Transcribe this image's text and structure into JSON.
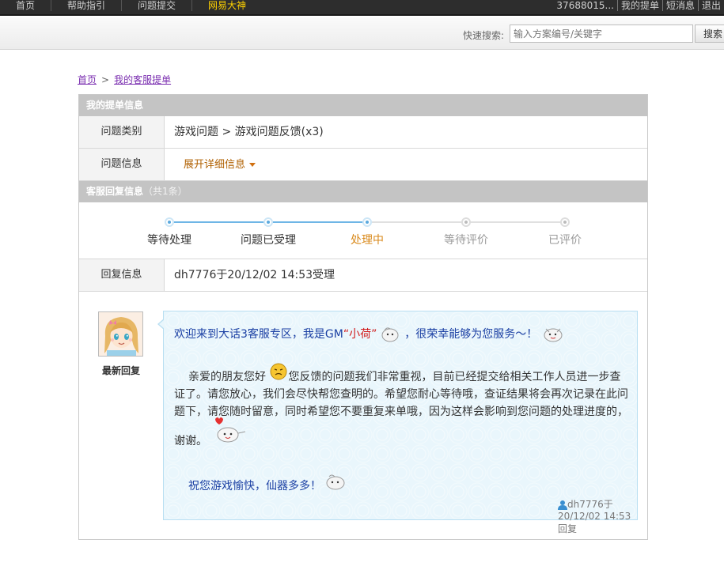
{
  "topnav": {
    "items": [
      "首页",
      "帮助指引",
      "问题提交",
      "网易大神"
    ],
    "right": [
      "37688015...",
      "我的提单",
      "短消息",
      "退出"
    ]
  },
  "search": {
    "label": "快速搜索:",
    "placeholder": "输入方案编号/关键字",
    "button": "搜索"
  },
  "breadcrumb": {
    "home": "首页",
    "current": "我的客服提单"
  },
  "ticket_info": {
    "header": "我的提单信息",
    "category_label": "问题类别",
    "category_value": "游戏问题 > 游戏问题反馈(x3)",
    "info_label": "问题信息",
    "expand_link": "展开详细信息"
  },
  "reply_info": {
    "header": "客服回复信息",
    "count": "（共1条）",
    "steps": [
      {
        "label": "等待处理",
        "state": "done"
      },
      {
        "label": "问题已受理",
        "state": "done"
      },
      {
        "label": "处理中",
        "state": "current"
      },
      {
        "label": "等待评价",
        "state": "pending"
      },
      {
        "label": "已评价",
        "state": "pending"
      }
    ],
    "reply_label": "回复信息",
    "reply_value": "dh7776于20/12/02 14:53受理"
  },
  "latest_reply": {
    "caption": "最新回复",
    "line1_a": "欢迎来到大话3客服专区，我是GM",
    "line1_name": "“小荷”",
    "line1_b": "，很荣幸能够为您服务～！",
    "para_a": "亲爱的朋友您好",
    "para_line1": "您反馈的问题我们非常重视，目前已经提交给相关工作人员进一步查",
    "para_line2": "证了。请您放心，我们会尽快帮您查明的。希望您耐心等待哦，查证结果将会再次记录在此问",
    "para_line3": "题下，请您随时留意，同时希望您不要重复来单哦，因为这样会影响到您问题的处理进度的，",
    "para_line4": "谢谢。",
    "closing": "祝您游戏愉快，仙器多多！",
    "footer": "dh7776于20/12/02 14:53回复"
  },
  "colors": {
    "accent_blue": "#5aa9de",
    "current_step": "#d98a1c",
    "link_purple": "#7b2fb0",
    "bubble_bg": "#e9f6fc"
  }
}
